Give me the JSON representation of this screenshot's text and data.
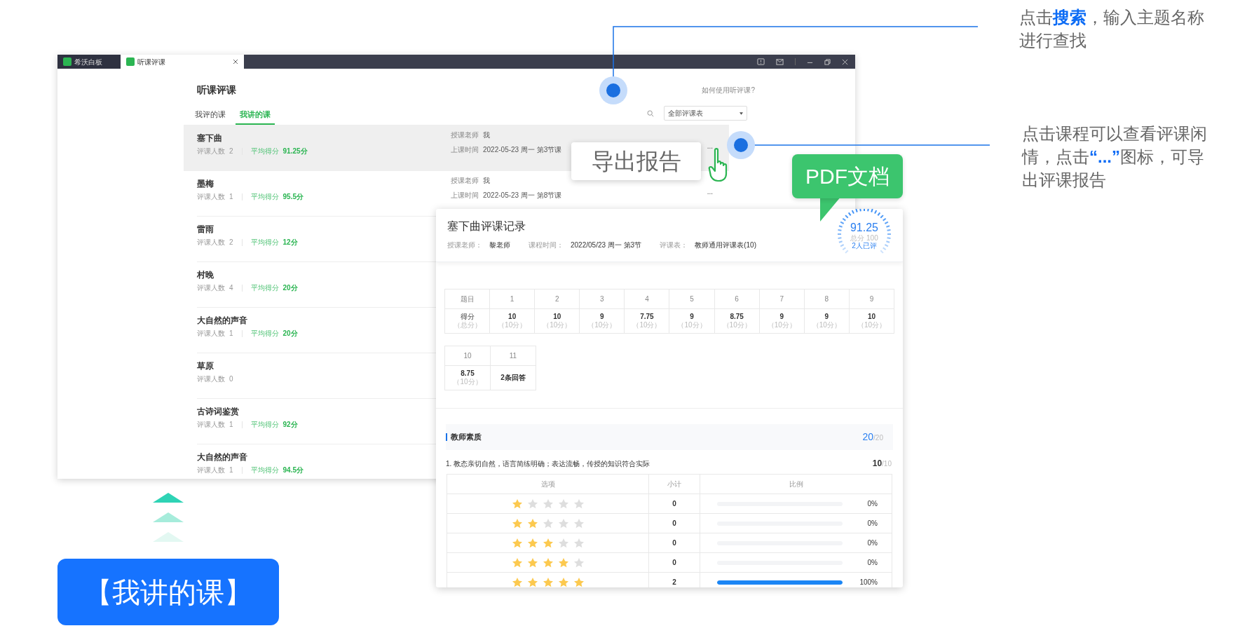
{
  "annotations": [
    {
      "text": "点击**搜索**，输入主题名称进行查找"
    },
    {
      "text": "点击课程可以查看评课闲情，点击**“...”**图标，可导出评课报告"
    }
  ],
  "window": {
    "tabs": [
      {
        "label": "希沃白板",
        "selected": false,
        "closable": false
      },
      {
        "label": "听课评课",
        "selected": true,
        "closable": true
      }
    ]
  },
  "app": {
    "title": "听课评课",
    "help": "如何使用听评课?",
    "nav_tabs": [
      {
        "label": "我评的课",
        "selected": false
      },
      {
        "label": "我讲的课",
        "selected": true
      }
    ],
    "filter": "全部评课表",
    "courses": [
      {
        "title": "塞下曲",
        "reviewers_label": "评课人数",
        "reviewers": "2",
        "avg_label": "平均得分",
        "avg": "91.25分",
        "selected": true,
        "teacher_label": "授课老师",
        "teacher": "我",
        "time_label": "上课时间",
        "time": "2022-05-23 周一 第3节课",
        "more": "..."
      },
      {
        "title": "墨梅",
        "reviewers_label": "评课人数",
        "reviewers": "1",
        "avg_label": "平均得分",
        "avg": "95.5分",
        "selected": false,
        "teacher_label": "授课老师",
        "teacher": "我",
        "time_label": "上课时间",
        "time": "2022-05-23 周一 第8节课",
        "more": "..."
      },
      {
        "title": "雷雨",
        "reviewers_label": "评课人数",
        "reviewers": "2",
        "avg_label": "平均得分",
        "avg": "12分",
        "selected": false
      },
      {
        "title": "村晚",
        "reviewers_label": "评课人数",
        "reviewers": "4",
        "avg_label": "平均得分",
        "avg": "20分",
        "selected": false
      },
      {
        "title": "大自然的声音",
        "reviewers_label": "评课人数",
        "reviewers": "1",
        "avg_label": "平均得分",
        "avg": "20分",
        "selected": false
      },
      {
        "title": "草原",
        "reviewers_label": "评课人数",
        "reviewers": "0",
        "selected": false
      },
      {
        "title": "古诗词鉴赏",
        "reviewers_label": "评课人数",
        "reviewers": "1",
        "avg_label": "平均得分",
        "avg": "92分",
        "selected": false
      },
      {
        "title": "大自然的声音",
        "reviewers_label": "评课人数",
        "reviewers": "1",
        "avg_label": "平均得分",
        "avg": "94.5分",
        "selected": false
      }
    ]
  },
  "export_tooltip": "导出报告",
  "pdf_callout": "PDF文档",
  "report": {
    "title": "塞下曲评课记录",
    "meta": [
      {
        "label": "授课老师：",
        "value": "黎老师"
      },
      {
        "label": "课程时间：",
        "value": "2022/05/23 周一 第3节"
      },
      {
        "label": "评课表：",
        "value": "教师通用评课表(10)"
      }
    ],
    "score": "91.25",
    "score_total": "总分 100",
    "reviewed": "2人已评",
    "score_table": {
      "header_label": "题目",
      "score_label": "得分",
      "score_sub": "（总分）",
      "items": [
        {
          "number": "1",
          "score": "10",
          "max": "（10分）"
        },
        {
          "number": "2",
          "score": "10",
          "max": "（10分）"
        },
        {
          "number": "3",
          "score": "9",
          "max": "（10分）"
        },
        {
          "number": "4",
          "score": "7.75",
          "max": "（10分）"
        },
        {
          "number": "5",
          "score": "9",
          "max": "（10分）"
        },
        {
          "number": "6",
          "score": "8.75",
          "max": "（10分）"
        },
        {
          "number": "7",
          "score": "9",
          "max": "（10分）"
        },
        {
          "number": "8",
          "score": "9",
          "max": "（10分）"
        },
        {
          "number": "9",
          "score": "10",
          "max": "（10分）"
        },
        {
          "number": "10",
          "score": "8.75",
          "max": "（10分）"
        },
        {
          "number": "11",
          "score": "2条回答"
        }
      ]
    },
    "section": {
      "title": "教师素质",
      "score": "20",
      "total": "/20"
    },
    "question": {
      "text": "1. 教态亲切自然，语言简练明确；表达流畅，传授的知识符合实际",
      "score": "10",
      "total": "/10"
    },
    "options_table": {
      "columns": [
        "选项",
        "小计",
        "比例"
      ],
      "rows": [
        {
          "stars": 1,
          "count": "0",
          "level": 0,
          "percent": "0%"
        },
        {
          "stars": 2,
          "count": "0",
          "level": 0,
          "percent": "0%"
        },
        {
          "stars": 3,
          "count": "0",
          "level": 0,
          "percent": "0%"
        },
        {
          "stars": 4,
          "count": "0",
          "level": 0,
          "percent": "0%"
        },
        {
          "stars": 5,
          "count": "2",
          "level": 1,
          "percent": "100%"
        }
      ]
    }
  },
  "badge": "【我讲的课】"
}
